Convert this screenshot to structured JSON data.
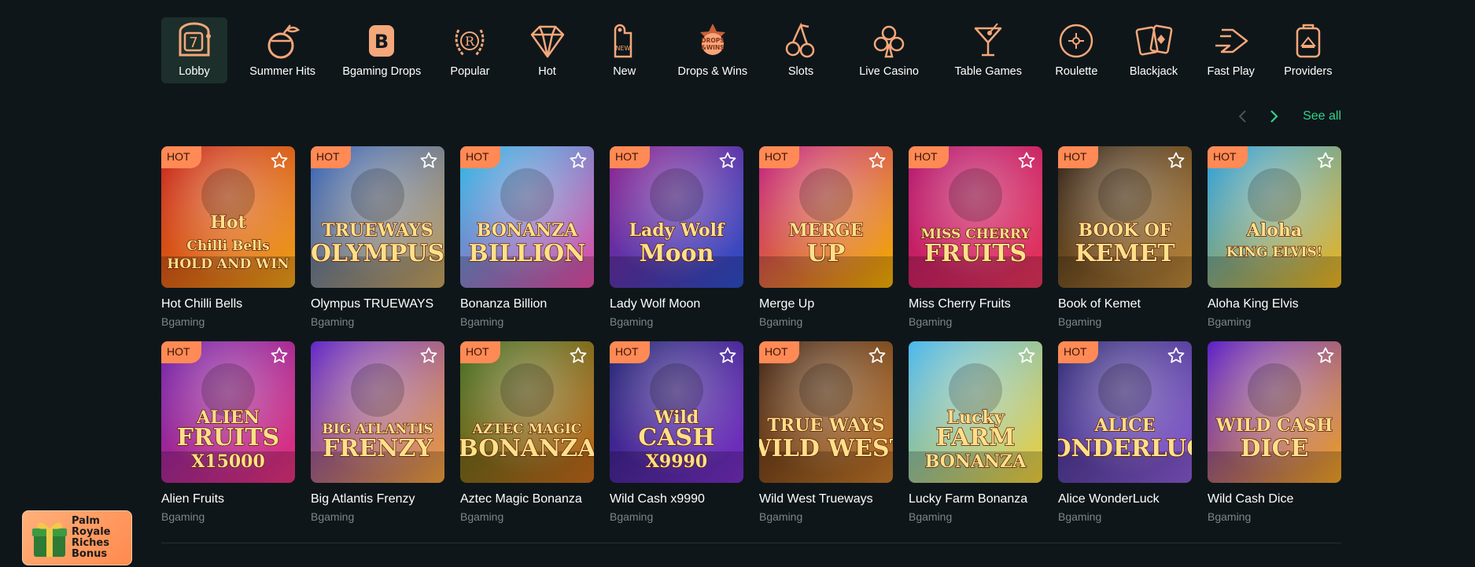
{
  "categories": [
    {
      "label": "Lobby",
      "icon": "slot-seven-icon",
      "active": true
    },
    {
      "label": "Summer Hits",
      "icon": "coconut-drink-icon"
    },
    {
      "label": "Bgaming Drops",
      "icon": "b-badge-icon"
    },
    {
      "label": "Popular",
      "icon": "laurel-r-icon"
    },
    {
      "label": "Hot",
      "icon": "diamond-icon"
    },
    {
      "label": "New",
      "icon": "new-tag-icon"
    },
    {
      "label": "Drops & Wins",
      "icon": "drops-wins-icon"
    },
    {
      "label": "Slots",
      "icon": "cherries-icon"
    },
    {
      "label": "Live Casino",
      "icon": "club-icon"
    },
    {
      "label": "Table Games",
      "icon": "cocktail-icon"
    },
    {
      "label": "Roulette",
      "icon": "roulette-icon"
    },
    {
      "label": "Blackjack",
      "icon": "cards-icon"
    },
    {
      "label": "Fast Play",
      "icon": "fast-arrow-icon"
    },
    {
      "label": "Providers",
      "icon": "bag-icon"
    }
  ],
  "pager": {
    "see_all": "See all"
  },
  "badge_label": "HOT",
  "games": [
    {
      "title": "Hot Chilli Bells",
      "provider": "Bgaming",
      "hot": true,
      "art": [
        "Hot",
        "Chilli Bells",
        "HOLD AND WIN"
      ],
      "colors": [
        "#c41a12",
        "#f2a51a"
      ]
    },
    {
      "title": "Olympus TRUEWAYS",
      "provider": "Bgaming",
      "hot": true,
      "art": [
        "TRUEWAYS",
        "OLYMPUS"
      ],
      "colors": [
        "#2c5db8",
        "#c9a45c"
      ]
    },
    {
      "title": "Bonanza Billion",
      "provider": "Bgaming",
      "hot": true,
      "art": [
        "BONANZA",
        "BILLION"
      ],
      "colors": [
        "#23b6e8",
        "#e84aa5"
      ]
    },
    {
      "title": "Lady Wolf Moon",
      "provider": "Bgaming",
      "hot": true,
      "art": [
        "Lady Wolf",
        "Moon"
      ],
      "colors": [
        "#8a1a8a",
        "#2b4fc9"
      ]
    },
    {
      "title": "Merge Up",
      "provider": "Bgaming",
      "hot": true,
      "art": [
        "MERGE",
        "UP"
      ],
      "colors": [
        "#c0157e",
        "#f6b400"
      ]
    },
    {
      "title": "Miss Cherry Fruits",
      "provider": "Bgaming",
      "hot": true,
      "art": [
        "MISS CHERRY",
        "FRUITS"
      ],
      "colors": [
        "#b1106a",
        "#e7365c"
      ]
    },
    {
      "title": "Book of Kemet",
      "provider": "Bgaming",
      "hot": true,
      "art": [
        "BOOK OF",
        "KEMET"
      ],
      "colors": [
        "#2a1a10",
        "#c08a3a"
      ]
    },
    {
      "title": "Aloha King Elvis",
      "provider": "Bgaming",
      "hot": true,
      "art": [
        "Aloha",
        "KING ELVIS!"
      ],
      "colors": [
        "#1f9be0",
        "#f2b71e"
      ]
    },
    {
      "title": "Alien Fruits",
      "provider": "Bgaming",
      "hot": true,
      "art": [
        "ALIEN",
        "FRUITS",
        "X15000"
      ],
      "colors": [
        "#6b1fa8",
        "#e8327c"
      ]
    },
    {
      "title": "Big Atlantis Frenzy",
      "provider": "Bgaming",
      "hot": false,
      "art": [
        "BIG ATLANTIS",
        "FRENZY"
      ],
      "colors": [
        "#6127c9",
        "#f2a23a"
      ]
    },
    {
      "title": "Aztec Magic Bonanza",
      "provider": "Bgaming",
      "hot": true,
      "art": [
        "AZTEC MAGIC",
        "BONANZA"
      ],
      "colors": [
        "#3b6a1a",
        "#c56a1a"
      ]
    },
    {
      "title": "Wild Cash x9990",
      "provider": "Bgaming",
      "hot": true,
      "art": [
        "Wild",
        "CASH",
        "X9990"
      ],
      "colors": [
        "#1b1f6e",
        "#7a2fc8"
      ]
    },
    {
      "title": "Wild West Trueways",
      "provider": "Bgaming",
      "hot": true,
      "art": [
        "TRUE WAYS",
        "WILD WEST"
      ],
      "colors": [
        "#3a1e10",
        "#c87a2a"
      ]
    },
    {
      "title": "Lucky Farm Bonanza",
      "provider": "Bgaming",
      "hot": false,
      "art": [
        "Lucky",
        "FARM",
        "BONANZA"
      ],
      "colors": [
        "#49b7ef",
        "#f3d23a"
      ]
    },
    {
      "title": "Alice WonderLuck",
      "provider": "Bgaming",
      "hot": true,
      "art": [
        "ALICE",
        "WONDERLUCK"
      ],
      "colors": [
        "#2a2570",
        "#8b5cd6"
      ]
    },
    {
      "title": "Wild Cash Dice",
      "provider": "Bgaming",
      "hot": false,
      "art": [
        "WILD CASH",
        "DICE"
      ],
      "colors": [
        "#5b1fc7",
        "#f5a623"
      ]
    }
  ],
  "promo": {
    "text": "Palm Royale Riches Bonus",
    "icon": "gift-icon"
  },
  "colors": {
    "background": "#0f1619",
    "accent": "#2ed38c",
    "icon": "#f4a77a",
    "hot_badge": "#ff8a55"
  }
}
